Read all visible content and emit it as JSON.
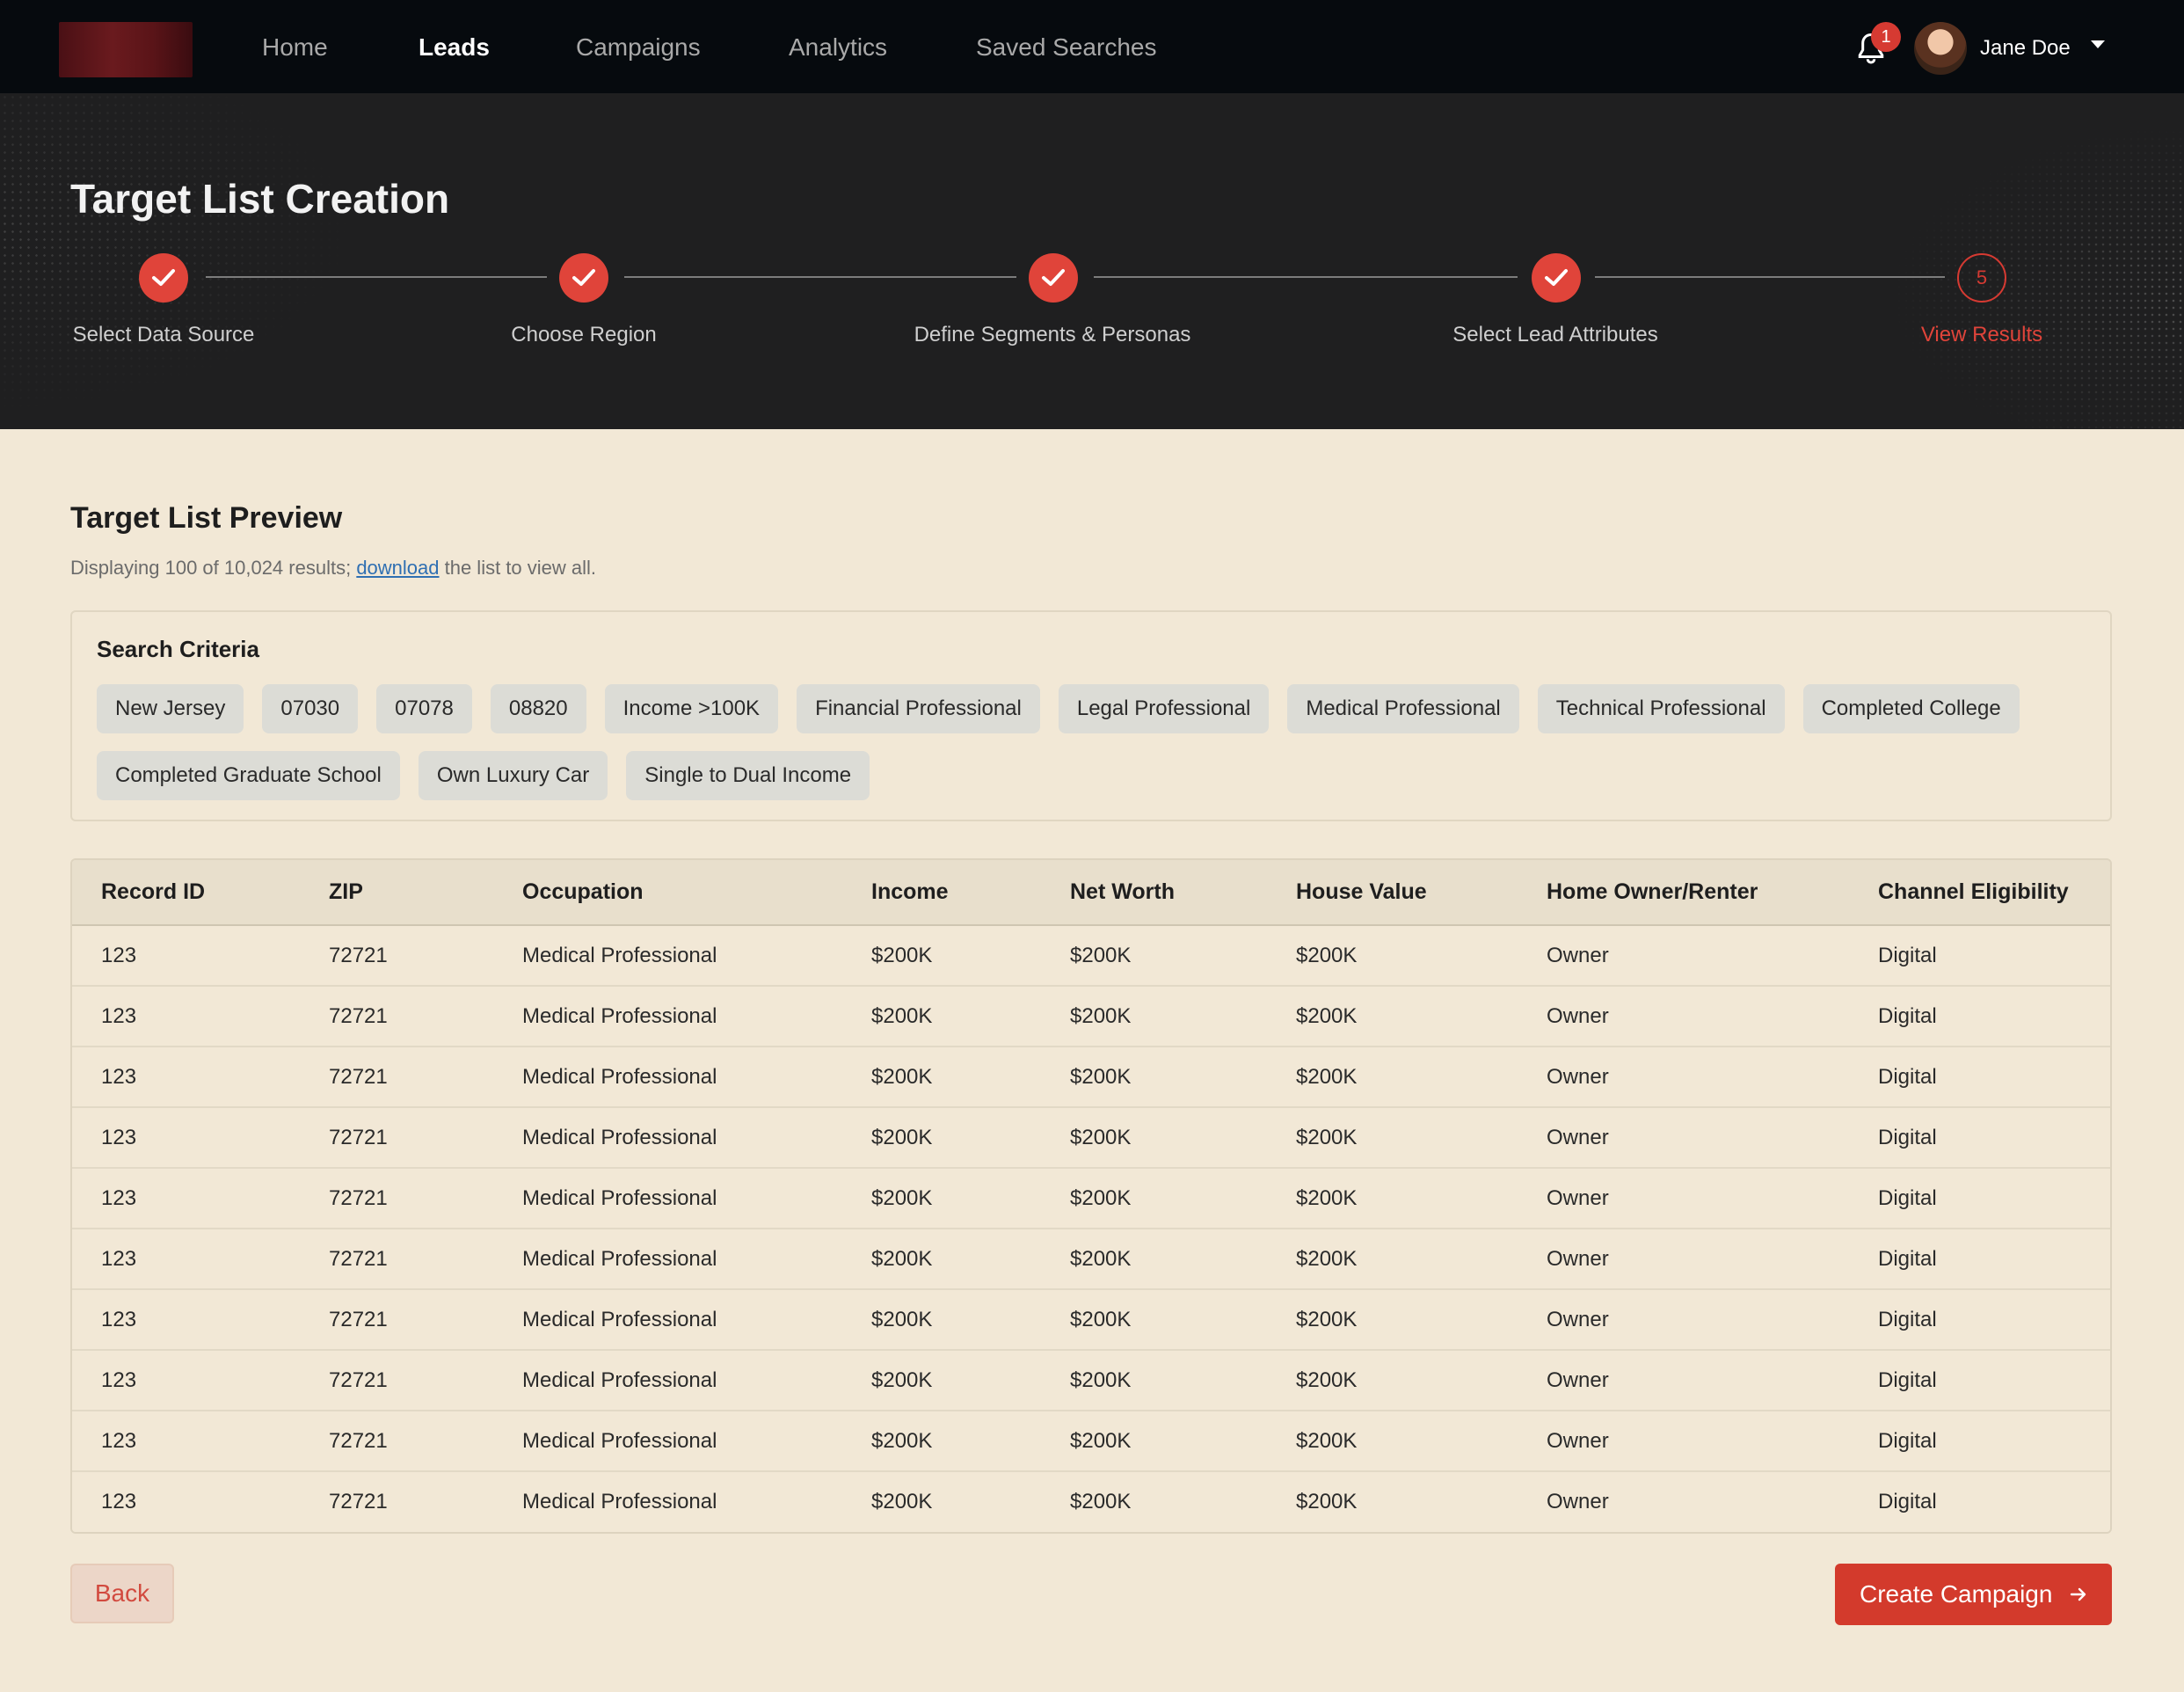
{
  "nav": {
    "items": [
      {
        "label": "Home",
        "active": false
      },
      {
        "label": "Leads",
        "active": true
      },
      {
        "label": "Campaigns",
        "active": false
      },
      {
        "label": "Analytics",
        "active": false
      },
      {
        "label": "Saved Searches",
        "active": false
      }
    ],
    "notifications": "1",
    "user_name": "Jane Doe"
  },
  "hero": {
    "title": "Target List Creation",
    "steps": [
      {
        "label": "Select Data Source",
        "state": "complete"
      },
      {
        "label": "Choose Region",
        "state": "complete"
      },
      {
        "label": "Define Segments & Personas",
        "state": "complete"
      },
      {
        "label": "Select Lead Attributes",
        "state": "complete"
      },
      {
        "label": "View Results",
        "state": "current",
        "number": "5"
      }
    ]
  },
  "preview": {
    "title": "Target List Preview",
    "subtitle_prefix": "Displaying 100 of 10,024 results; ",
    "download_link": "download",
    "subtitle_suffix": " the list to view all."
  },
  "criteria": {
    "title": "Search Criteria",
    "chips": [
      "New Jersey",
      "07030",
      "07078",
      "08820",
      "Income >100K",
      "Financial Professional",
      "Legal Professional",
      "Medical Professional",
      "Technical Professional",
      "Completed College",
      "Completed Graduate School",
      "Own Luxury Car",
      "Single to Dual Income"
    ]
  },
  "table": {
    "columns": [
      "Record ID",
      "ZIP",
      "Occupation",
      "Income",
      "Net Worth",
      "House Value",
      "Home Owner/Renter",
      "Channel Eligibility"
    ],
    "rows": [
      [
        "123",
        "72721",
        "Medical Professional",
        "$200K",
        "$200K",
        "$200K",
        "Owner",
        "Digital"
      ],
      [
        "123",
        "72721",
        "Medical Professional",
        "$200K",
        "$200K",
        "$200K",
        "Owner",
        "Digital"
      ],
      [
        "123",
        "72721",
        "Medical Professional",
        "$200K",
        "$200K",
        "$200K",
        "Owner",
        "Digital"
      ],
      [
        "123",
        "72721",
        "Medical Professional",
        "$200K",
        "$200K",
        "$200K",
        "Owner",
        "Digital"
      ],
      [
        "123",
        "72721",
        "Medical Professional",
        "$200K",
        "$200K",
        "$200K",
        "Owner",
        "Digital"
      ],
      [
        "123",
        "72721",
        "Medical Professional",
        "$200K",
        "$200K",
        "$200K",
        "Owner",
        "Digital"
      ],
      [
        "123",
        "72721",
        "Medical Professional",
        "$200K",
        "$200K",
        "$200K",
        "Owner",
        "Digital"
      ],
      [
        "123",
        "72721",
        "Medical Professional",
        "$200K",
        "$200K",
        "$200K",
        "Owner",
        "Digital"
      ],
      [
        "123",
        "72721",
        "Medical Professional",
        "$200K",
        "$200K",
        "$200K",
        "Owner",
        "Digital"
      ],
      [
        "123",
        "72721",
        "Medical Professional",
        "$200K",
        "$200K",
        "$200K",
        "Owner",
        "Digital"
      ]
    ]
  },
  "actions": {
    "back_label": "Back",
    "create_label": "Create Campaign"
  },
  "colors": {
    "accent": "#d33a2c",
    "nav_bg": "#060a0e",
    "hero_bg": "#1f1f20",
    "page_bg": "#f2e8d6"
  }
}
